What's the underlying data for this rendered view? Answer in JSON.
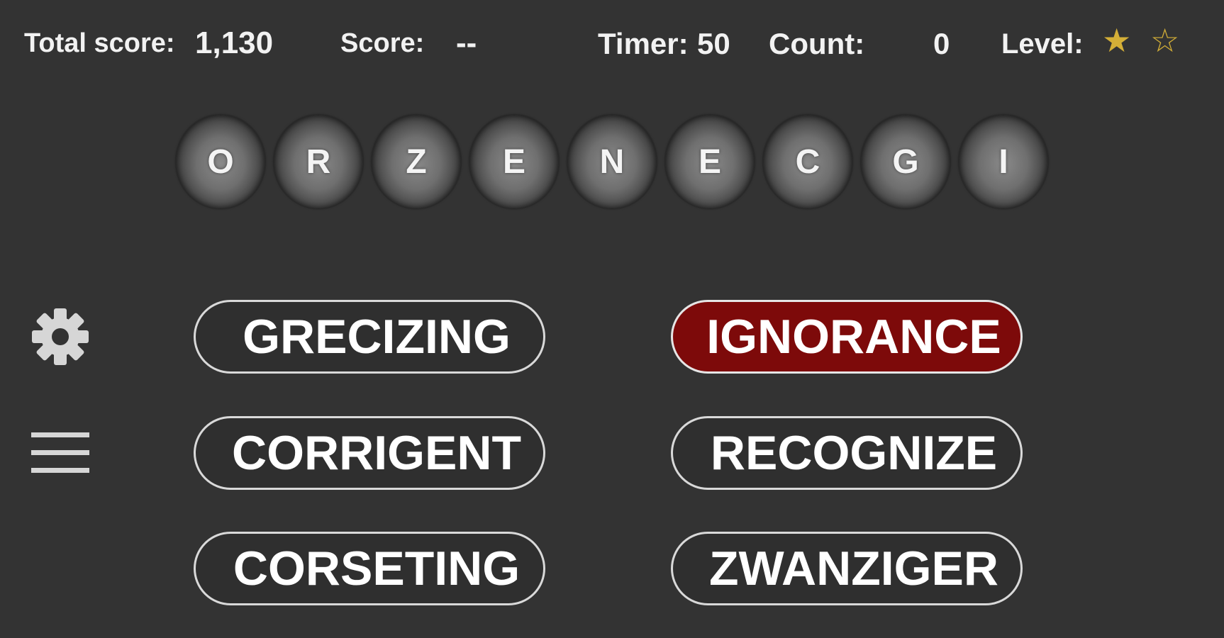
{
  "hud": {
    "total_score_label": "Total score:",
    "total_score_value": "1,130",
    "score_label": "Score:",
    "score_value": "--",
    "timer_label": "Timer:",
    "timer_value": "50",
    "count_label": "Count:",
    "count_value": "0",
    "level_label": "Level:",
    "level_stars_filled": 1,
    "level_stars_total": 2,
    "star_filled_glyph": "★",
    "star_empty_glyph": "☆",
    "star_color": "#d4af37"
  },
  "letters": [
    "O",
    "R",
    "Z",
    "E",
    "N",
    "E",
    "C",
    "G",
    "I"
  ],
  "side_icons": [
    "gear-icon",
    "menu-icon"
  ],
  "answers": {
    "left": [
      "GRECIZING",
      "CORRIGENT",
      "CORSETING"
    ],
    "right": [
      "IGNORANCE",
      "RECOGNIZE",
      "ZWANZIGER"
    ],
    "selected": "IGNORANCE",
    "selected_color": "#7d0a0a"
  }
}
